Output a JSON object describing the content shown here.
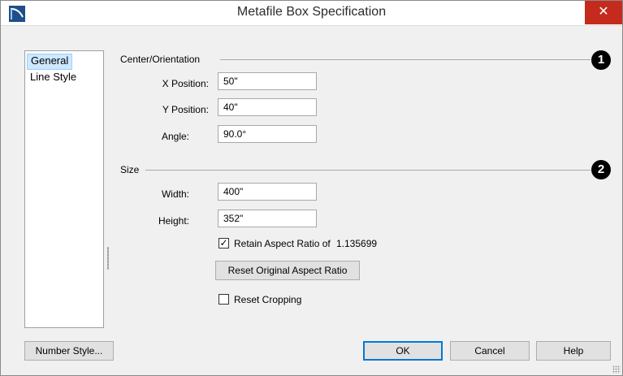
{
  "window": {
    "title": "Metafile Box Specification",
    "close_label": "✕"
  },
  "sidebar": {
    "items": [
      {
        "label": "General",
        "selected": true
      },
      {
        "label": "Line Style",
        "selected": false
      }
    ]
  },
  "center_orientation": {
    "heading": "Center/Orientation",
    "callout": "1",
    "x_label": "X Position:",
    "x_value": "50\"",
    "y_label": "Y Position:",
    "y_value": "40\"",
    "angle_label": "Angle:",
    "angle_value": "90.0°"
  },
  "size": {
    "heading": "Size",
    "callout": "2",
    "width_label": "Width:",
    "width_value": "400\"",
    "height_label": "Height:",
    "height_value": "352\"",
    "retain_label": "Retain Aspect Ratio of",
    "retain_checked": true,
    "aspect_ratio": "1.135699",
    "reset_aspect_label": "Reset Original Aspect Ratio",
    "reset_cropping_label": "Reset Cropping",
    "reset_cropping_checked": false
  },
  "footer": {
    "number_style_label": "Number Style...",
    "ok_label": "OK",
    "cancel_label": "Cancel",
    "help_label": "Help"
  },
  "colors": {
    "close_bg": "#c42b1c",
    "selection_bg": "#cde8ff",
    "default_button_border": "#0078d7"
  }
}
